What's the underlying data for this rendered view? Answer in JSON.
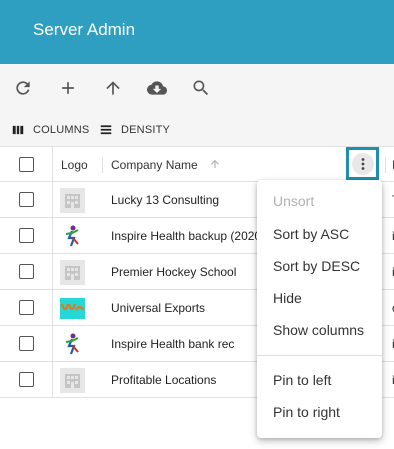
{
  "app": {
    "title": "Server Admin"
  },
  "toolbar": {
    "icons": [
      "refresh-icon",
      "add-icon",
      "upload-icon",
      "cloud-download-icon",
      "search-icon"
    ]
  },
  "grid_toolbar": {
    "columns_label": "COLUMNS",
    "density_label": "DENSITY"
  },
  "grid": {
    "columns": {
      "logo": "Logo",
      "company": "Company Name",
      "next_partial": "I"
    },
    "rows": [
      {
        "company": "Lucky 13 Consulting",
        "logo": "building-placeholder",
        "rest": "T"
      },
      {
        "company": "Inspire Health backup (2020",
        "logo": "inspire-health-figure",
        "rest": "i"
      },
      {
        "company": "Premier Hockey School",
        "logo": "building-placeholder",
        "rest": "i"
      },
      {
        "company": "Universal Exports",
        "logo": "universal-exports-logo",
        "rest": "c"
      },
      {
        "company": "Inspire Health bank rec",
        "logo": "inspire-health-figure",
        "rest": "i"
      },
      {
        "company": "Profitable Locations",
        "logo": "building-placeholder",
        "rest": "i"
      }
    ]
  },
  "column_menu": {
    "items": [
      "Unsort",
      "Sort by ASC",
      "Sort by DESC",
      "Hide",
      "Show columns",
      "Pin to left",
      "Pin to right"
    ],
    "disabled": [
      "Unsort"
    ]
  },
  "colors": {
    "appbar": "#2e9fc1",
    "highlight": "#1d8fb0"
  }
}
